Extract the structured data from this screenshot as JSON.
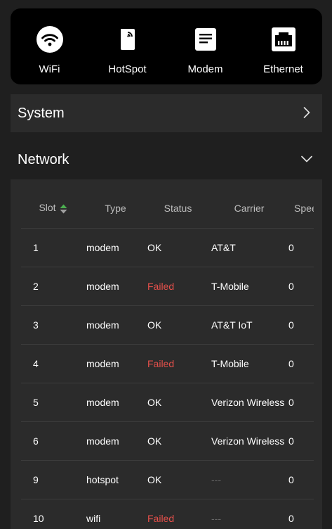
{
  "quick_connect": [
    {
      "id": "wifi",
      "label": "WiFi",
      "icon": "wifi-icon"
    },
    {
      "id": "hotspot",
      "label": "HotSpot",
      "icon": "phone-signal-icon"
    },
    {
      "id": "modem",
      "label": "Modem",
      "icon": "document-icon"
    },
    {
      "id": "ethernet",
      "label": "Ethernet",
      "icon": "ethernet-port-icon"
    }
  ],
  "sections": {
    "system": {
      "title": "System",
      "chevron": "chevron-right-icon"
    },
    "network": {
      "title": "Network",
      "chevron": "chevron-down-icon"
    }
  },
  "network_table": {
    "headers": {
      "slot": "Slot",
      "type": "Type",
      "status": "Status",
      "carrier": "Carrier",
      "speed": "Speed"
    },
    "sort_icon": "sort-up-down-icon",
    "rows": [
      {
        "slot": "1",
        "type": "modem",
        "status": "OK",
        "carrier": "AT&T",
        "speed": "0"
      },
      {
        "slot": "2",
        "type": "modem",
        "status": "Failed",
        "carrier": "T-Mobile",
        "speed": "0"
      },
      {
        "slot": "3",
        "type": "modem",
        "status": "OK",
        "carrier": "AT&T IoT",
        "speed": "0"
      },
      {
        "slot": "4",
        "type": "modem",
        "status": "Failed",
        "carrier": "T-Mobile",
        "speed": "0"
      },
      {
        "slot": "5",
        "type": "modem",
        "status": "OK",
        "carrier": "Verizon Wireless",
        "speed": "0"
      },
      {
        "slot": "6",
        "type": "modem",
        "status": "OK",
        "carrier": "Verizon Wireless",
        "speed": "0"
      },
      {
        "slot": "9",
        "type": "hotspot",
        "status": "OK",
        "carrier": "---",
        "speed": "0"
      },
      {
        "slot": "10",
        "type": "wifi",
        "status": "Failed",
        "carrier": "---",
        "speed": "0"
      }
    ]
  },
  "colors": {
    "background": "#1f1f1f",
    "panel": "#2b2b2b",
    "top_bar": "#000000",
    "failed": "#e5504b",
    "sort_up": "#4caf50",
    "sort_down": "#9e9e9e"
  }
}
